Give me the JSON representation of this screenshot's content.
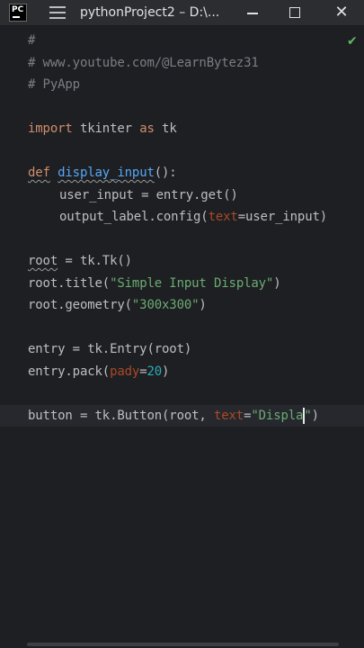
{
  "titlebar": {
    "logo": "PC",
    "project": "pythonProject2 – D:\\..."
  },
  "icons": {
    "logo": "pycharm-icon",
    "menu": "hamburger-icon",
    "minimize": "minimize-icon",
    "maximize": "maximize-icon",
    "close": "close-icon",
    "status": "check-icon"
  },
  "code": {
    "l1": "#",
    "l2": "# www.youtube.com/@LearnBytez31",
    "l3": "# PyApp",
    "l4_kw1": "import",
    "l4_mid": " tkinter ",
    "l4_kw2": "as",
    "l4_end": " tk",
    "l5_kw": "def",
    "l5_fn": "display_input",
    "l5_end": "():",
    "l6": "user_input = entry.get()",
    "l7_a": "output_label.config(",
    "l7_param": "text",
    "l7_b": "=user_input)",
    "l8_var": "root",
    "l8_end": " = tk.Tk()",
    "l9_a": "root.title(",
    "l9_str": "\"Simple Input Display\"",
    "l9_b": ")",
    "l10_a": "root.geometry(",
    "l10_str": "\"300x300\"",
    "l10_b": ")",
    "l11": "entry = tk.Entry(root)",
    "l12_a": "entry.pack(",
    "l12_param": "pady",
    "l12_eq": "=",
    "l12_num": "20",
    "l12_b": ")",
    "l13_a": "button = tk.Button(root, ",
    "l13_param": "text",
    "l13_eq": "=",
    "l13_str": "\"Displa",
    "l13_str2": "\"",
    "l13_b": ")"
  },
  "colors": {
    "background": "#1e1f22",
    "keyword": "#cf8e6d",
    "function": "#56a8f5",
    "string": "#6aab73",
    "comment": "#7a7e85",
    "number": "#2aacb8",
    "parameter": "#aa4926"
  }
}
